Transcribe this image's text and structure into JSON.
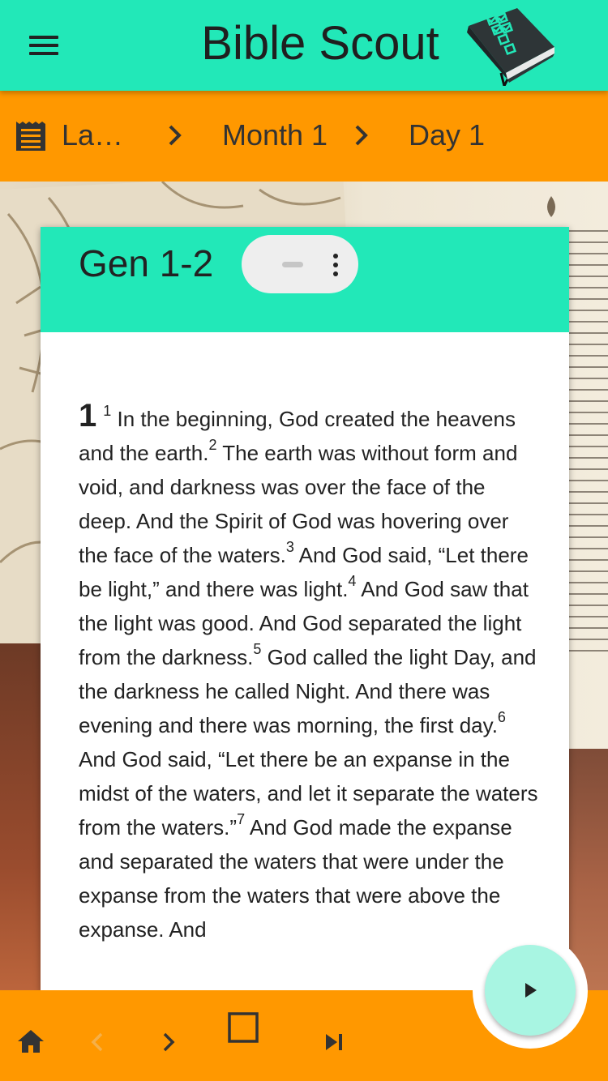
{
  "app": {
    "title": "Bible Scout"
  },
  "breadcrumb": {
    "plan_label": "La…",
    "month_label": "Month 1",
    "day_label": "Day 1"
  },
  "passage": {
    "reference": "Gen 1-2",
    "chapter": "1",
    "verses": [
      {
        "num": "1",
        "text": "In the beginning, God created the heavens and the earth."
      },
      {
        "num": "2",
        "text": "The earth was without form and void, and darkness was over the face of the deep. And the Spirit of God was hovering over the face of the waters."
      },
      {
        "num": "3",
        "text": "And God said, “Let there be light,” and there was light."
      },
      {
        "num": "4",
        "text": "And God saw that the light was good. And God separated the light from the darkness."
      },
      {
        "num": "5",
        "text": "God called the light Day, and the darkness he called Night. And there was evening and there was morning, the first day."
      },
      {
        "num": "6",
        "text": "And God said, “Let there be an expanse in the midst of the waters, and let it separate the waters from the waters.”"
      },
      {
        "num": "7",
        "text": "And God made the expanse and separated the waters that were under the expanse from the waters that were above the expanse. And"
      }
    ]
  },
  "colors": {
    "header": "#22e8b8",
    "bar": "#ff9800",
    "fab": "#a8f5e2"
  },
  "icons": {
    "menu": "menu-icon",
    "book": "bible-logo-icon",
    "plan": "reading-plan-icon",
    "home": "home-icon",
    "prev": "chevron-left-icon",
    "next": "chevron-right-icon",
    "stop": "stop-square-icon",
    "skip": "skip-next-icon",
    "play": "play-icon"
  }
}
